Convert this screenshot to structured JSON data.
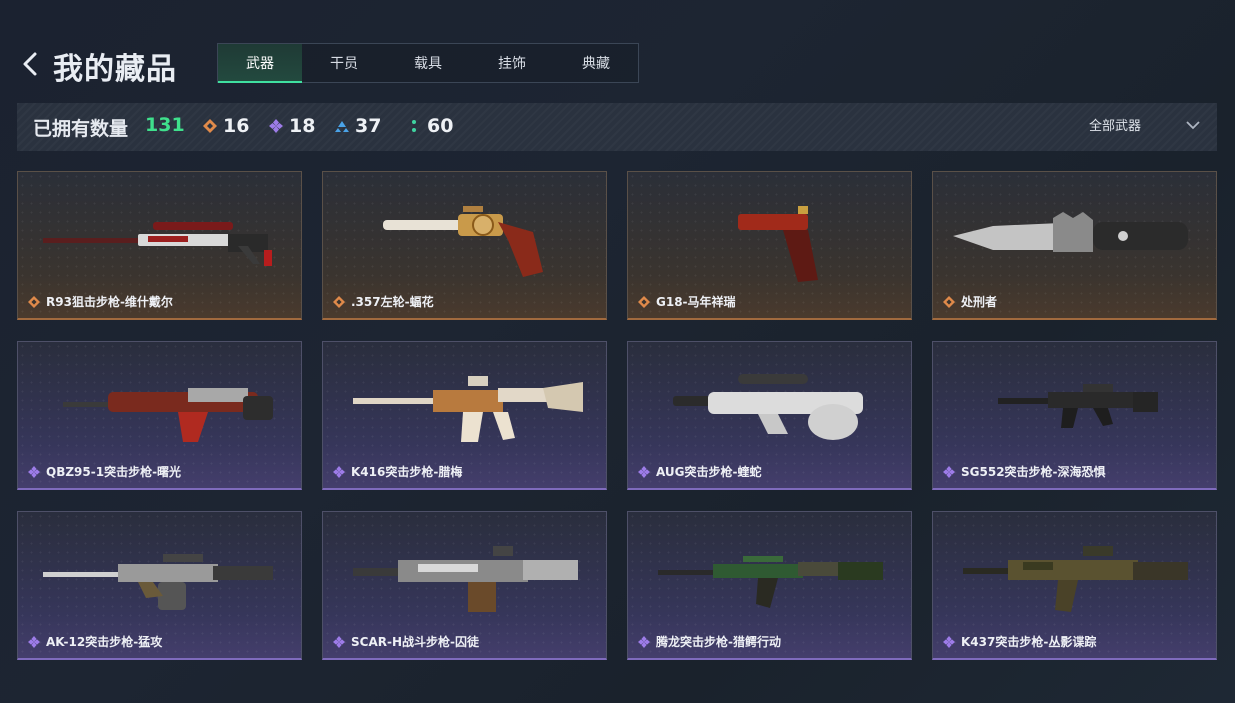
{
  "header": {
    "title": "我的藏品",
    "tabs": [
      {
        "label": "武器",
        "active": true
      },
      {
        "label": "干员",
        "active": false
      },
      {
        "label": "载具",
        "active": false
      },
      {
        "label": "挂饰",
        "active": false
      },
      {
        "label": "典藏",
        "active": false
      }
    ]
  },
  "stats": {
    "owned_label": "已拥有数量",
    "owned_count": "131",
    "rarities": [
      {
        "icon": "orange-diamond-icon",
        "color": "#e08a4a",
        "count": "16"
      },
      {
        "icon": "purple-diamond-icon",
        "color": "#9d7ce8",
        "count": "18"
      },
      {
        "icon": "blue-triangle-icon",
        "color": "#4aa3e8",
        "count": "37"
      },
      {
        "icon": "green-dots-icon",
        "color": "#3fd3a0",
        "count": "60"
      }
    ],
    "filter_label": "全部武器"
  },
  "items": [
    {
      "name": "R93狙击步枪-维什戴尔",
      "rarity": "orange",
      "kind": "sniper"
    },
    {
      "name": ".357左轮-蝠花",
      "rarity": "orange",
      "kind": "revolver"
    },
    {
      "name": "G18-马年祥瑞",
      "rarity": "orange",
      "kind": "pistol"
    },
    {
      "name": "处刑者",
      "rarity": "orange",
      "kind": "knife"
    },
    {
      "name": "QBZ95-1突击步枪-曙光",
      "rarity": "purple",
      "kind": "bullpup"
    },
    {
      "name": "K416突击步枪-腊梅",
      "rarity": "purple",
      "kind": "rifle"
    },
    {
      "name": "AUG突击步枪-蝰蛇",
      "rarity": "purple",
      "kind": "aug"
    },
    {
      "name": "SG552突击步枪-深海恐惧",
      "rarity": "purple",
      "kind": "carbine"
    },
    {
      "name": "AK-12突击步枪-猛攻",
      "rarity": "purple",
      "kind": "ak"
    },
    {
      "name": "SCAR-H战斗步枪-囚徒",
      "rarity": "purple",
      "kind": "scar"
    },
    {
      "name": "腾龙突击步枪-猎鳄行动",
      "rarity": "purple",
      "kind": "rifle2"
    },
    {
      "name": "K437突击步枪-丛影谍踪",
      "rarity": "purple",
      "kind": "rifle3"
    }
  ]
}
